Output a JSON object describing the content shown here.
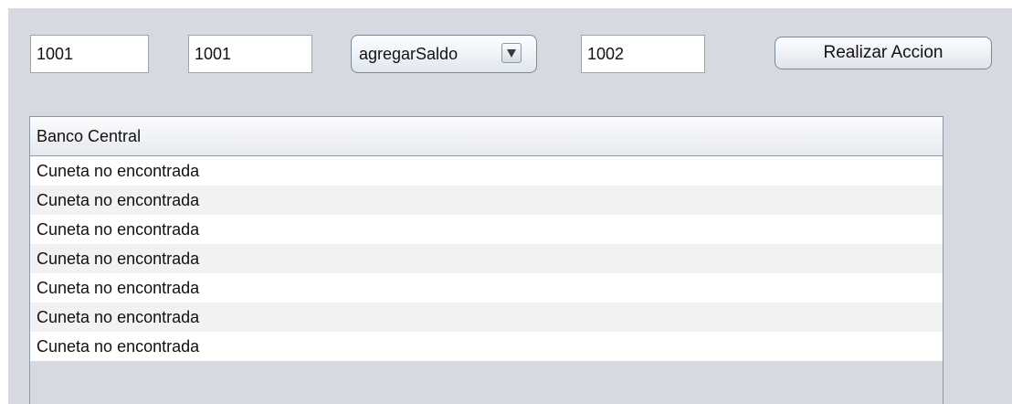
{
  "controls": {
    "field_1": "1001",
    "field_2": "1001",
    "action_select": "agregarSaldo",
    "field_3": "1002",
    "action_button": "Realizar Accion"
  },
  "table": {
    "header": "Banco Central",
    "rows": [
      "Cuneta no encontrada",
      "Cuneta no encontrada",
      "Cuneta no encontrada",
      "Cuneta no encontrada",
      "Cuneta no encontrada",
      "Cuneta no encontrada",
      "Cuneta no encontrada"
    ]
  },
  "icons": {
    "dropdown": "chevron-down-icon"
  }
}
